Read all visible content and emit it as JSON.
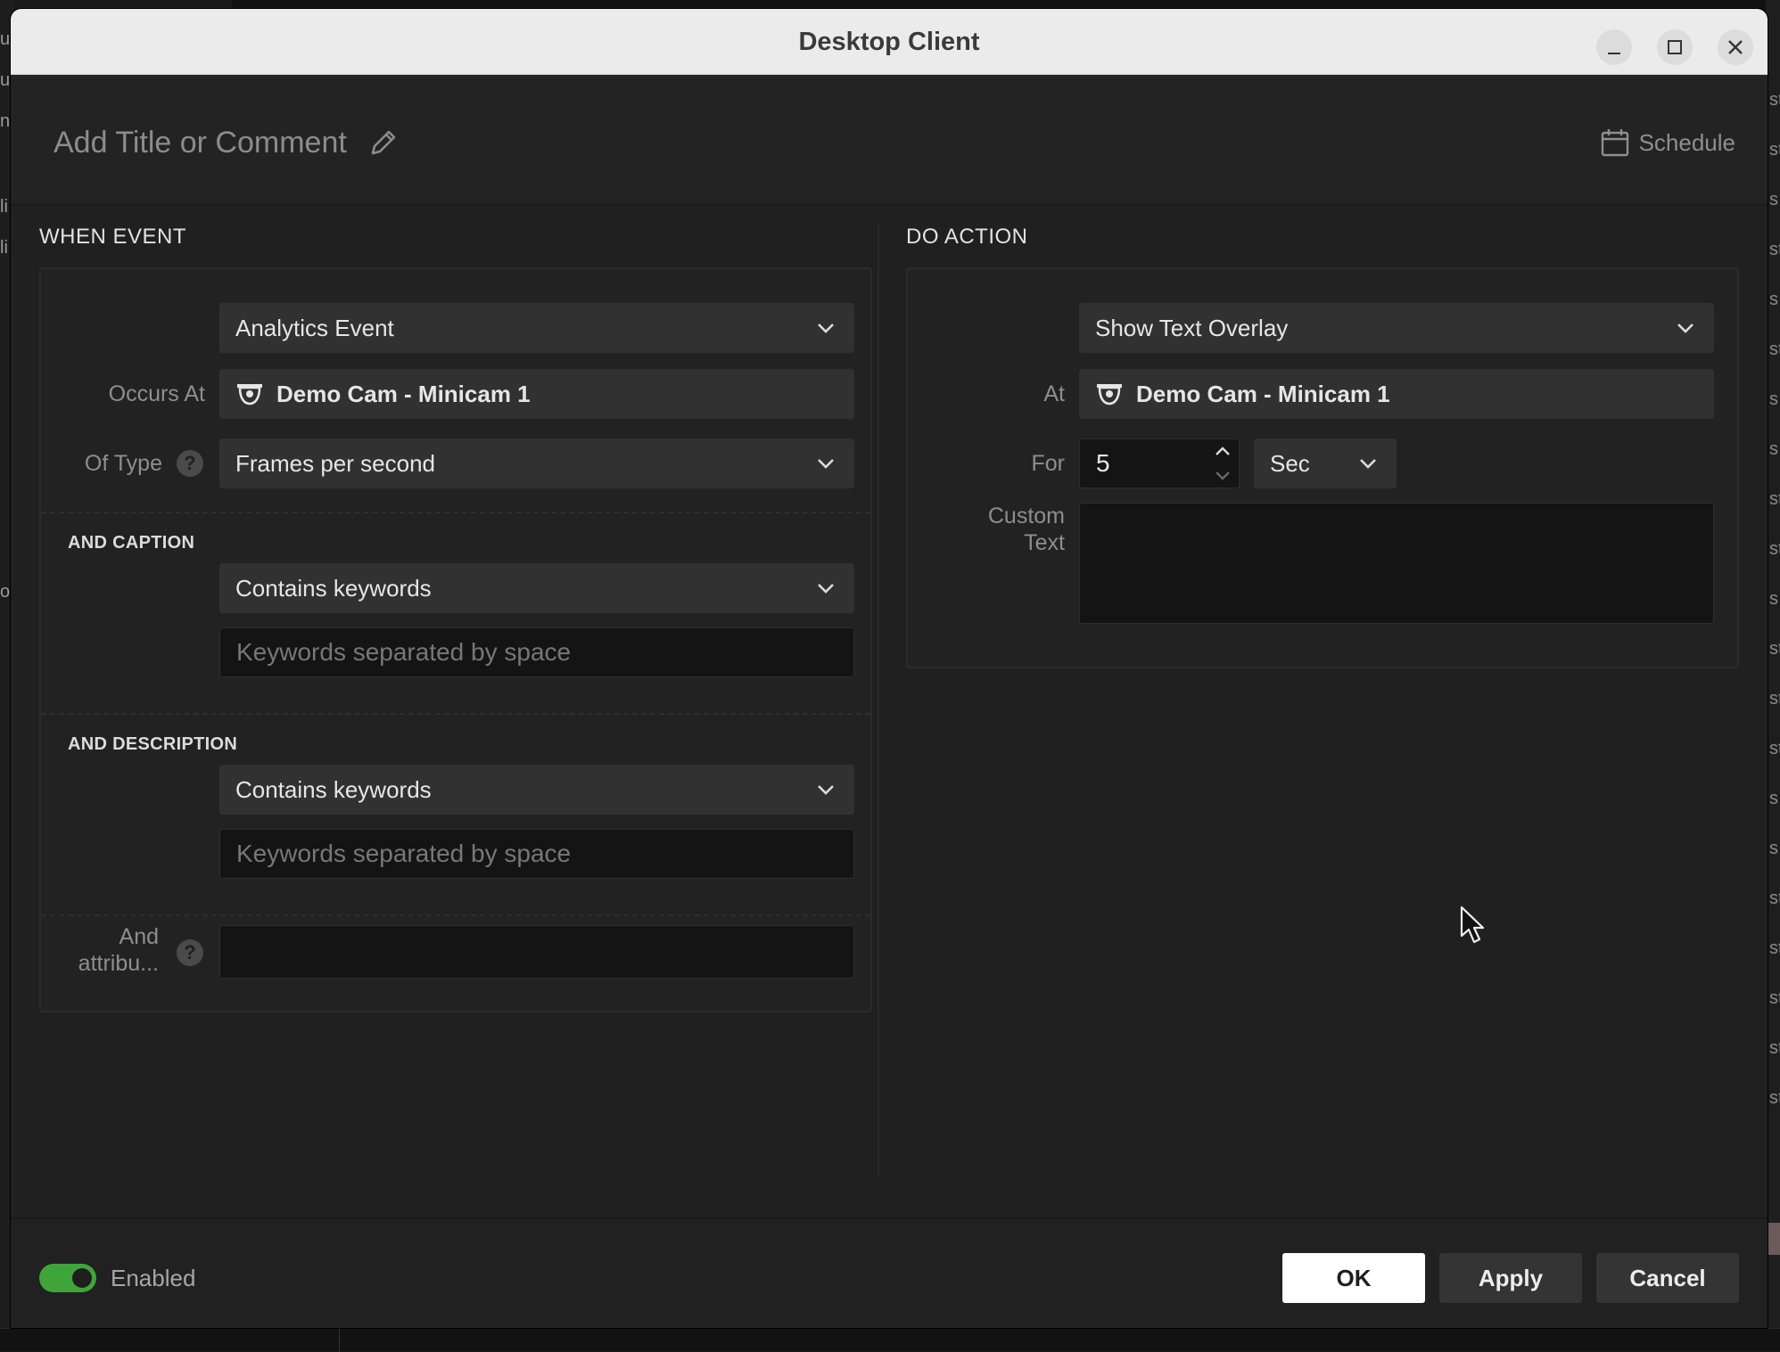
{
  "window": {
    "title": "Desktop Client"
  },
  "header": {
    "comment_placeholder": "Add Title or Comment",
    "schedule_label": "Schedule"
  },
  "when_event": {
    "section_title": "WHEN EVENT",
    "event_type": "Analytics Event",
    "occurs_at_label": "Occurs At",
    "occurs_at_value": "Demo Cam - Minicam 1",
    "of_type_label": "Of Type",
    "of_type_value": "Frames per second",
    "caption": {
      "heading": "AND CAPTION",
      "condition": "Contains keywords",
      "keywords_placeholder": "Keywords separated by space"
    },
    "description": {
      "heading": "AND DESCRIPTION",
      "condition": "Contains keywords",
      "keywords_placeholder": "Keywords separated by space"
    },
    "attributes_label_line1": "And",
    "attributes_label_line2": "attribu...",
    "attributes_value": ""
  },
  "do_action": {
    "section_title": "DO ACTION",
    "action_type": "Show Text Overlay",
    "at_label": "At",
    "at_value": "Demo Cam - Minicam 1",
    "for_label": "For",
    "duration_value": "5",
    "duration_unit": "Sec",
    "custom_text_label_line1": "Custom",
    "custom_text_label_line2": "Text",
    "custom_text_value": ""
  },
  "footer": {
    "enabled_label": "Enabled",
    "enabled": true,
    "ok_label": "OK",
    "apply_label": "Apply",
    "cancel_label": "Cancel"
  },
  "colors": {
    "accent_toggle": "#3fa53a",
    "dialog_bg": "#202020",
    "titlebar_bg": "#ebebeb"
  }
}
